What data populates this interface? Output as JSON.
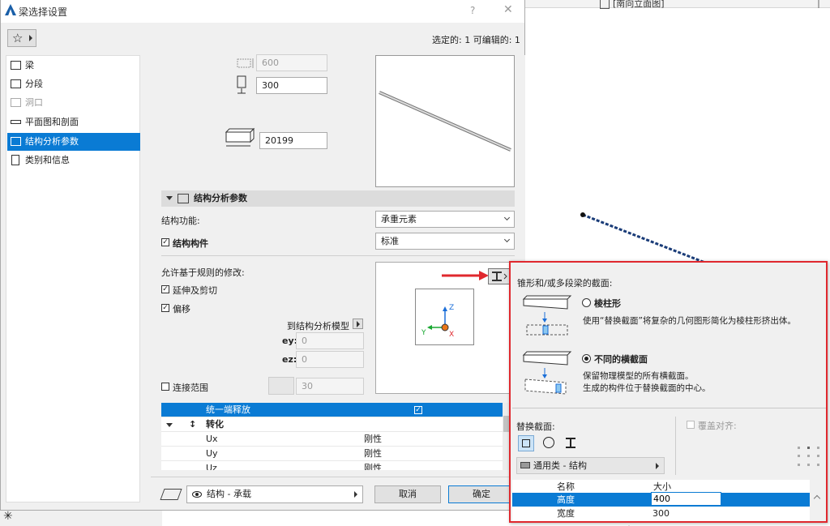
{
  "background": {
    "tab_label": "[南向立面图]"
  },
  "dialog": {
    "title": "梁选择设置",
    "help": "?",
    "close": "✕",
    "favorites_icon": "☆",
    "selection_info": "选定的: 1 可编辑的: 1"
  },
  "nav": {
    "items": [
      {
        "label": "梁",
        "icon": "beam-icon"
      },
      {
        "label": "分段",
        "icon": "segment-icon"
      },
      {
        "label": "洞口",
        "icon": "opening-icon"
      },
      {
        "label": "平面图和剖面",
        "icon": "plan-section-icon"
      },
      {
        "label": "结构分析参数",
        "icon": "structural-analysis-icon"
      },
      {
        "label": "类别和信息",
        "icon": "category-info-icon"
      }
    ]
  },
  "geometry": {
    "width_value": "600",
    "height_value": "300",
    "length_value": "20199"
  },
  "section": {
    "title": "结构分析参数",
    "struct_function_label": "结构功能:",
    "struct_function_value": "承重元素",
    "struct_member_label": "结构构件",
    "struct_member_value": "标准",
    "rules_label": "允许基于规则的修改:",
    "extend_trim_label": "延伸及剪切",
    "offset_label": "偏移",
    "to_model_label": "到结构分析模型",
    "ey_label": "ey:",
    "ey_value": "0",
    "ez_label": "ez:",
    "ez_value": "0",
    "connect_range_label": "连接范围",
    "connect_range_value": "30"
  },
  "axes": {
    "z": "Z",
    "y": "Y",
    "x": "X"
  },
  "release_table": {
    "rows": [
      {
        "name": "统一端释放",
        "value": "",
        "checked": true
      },
      {
        "name": "转化",
        "value": "",
        "group": true
      },
      {
        "name": "Ux",
        "value": "刚性"
      },
      {
        "name": "Uy",
        "value": "刚性"
      },
      {
        "name": "Uz",
        "value": "刚性"
      }
    ]
  },
  "bottom": {
    "layer_value": "结构 - 承载",
    "cancel": "取消",
    "ok": "确定"
  },
  "popup": {
    "heading": "锥形和/或多段梁的截面:",
    "option1_title": "棱柱形",
    "option1_desc": "使用“替换截面”将复杂的几何图形简化为棱柱形挤出体。",
    "option2_title": "不同的横截面",
    "option2_desc_1": "保留物理模型的所有横截面。",
    "option2_desc_2": "生成的构件位于替换截面的中心。",
    "replace_label": "替换截面:",
    "override_label": "覆盖对齐:",
    "profile_value": "通用类 - 结构",
    "table_headers": {
      "name": "名称",
      "size": "大小"
    },
    "table_rows": [
      {
        "name": "高度",
        "value": "400"
      },
      {
        "name": "宽度",
        "value": "300"
      }
    ]
  },
  "colors": {
    "selection": "#0a7bd4",
    "highlight_border": "#e0282e",
    "arrow": "#e0282e"
  }
}
